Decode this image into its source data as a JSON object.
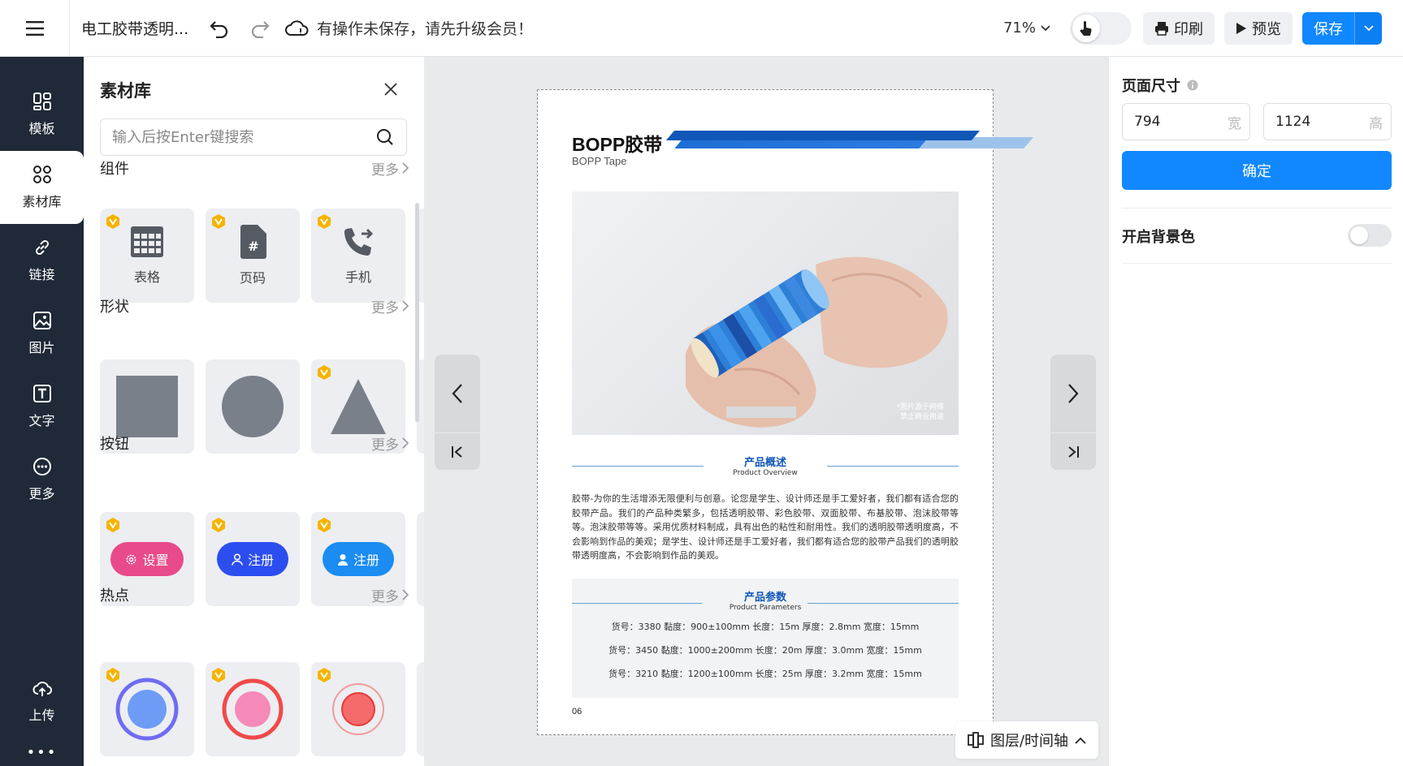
{
  "topbar": {
    "doc_title": "电工胶带透明...",
    "save_status": "有操作未保存，请先升级会员！",
    "zoom": "71%",
    "print_label": "印刷",
    "preview_label": "预览",
    "save_label": "保存"
  },
  "leftnav": {
    "items": [
      {
        "label": "模板"
      },
      {
        "label": "素材库"
      },
      {
        "label": "链接"
      },
      {
        "label": "图片"
      },
      {
        "label": "文字"
      },
      {
        "label": "更多"
      },
      {
        "label": "上传"
      }
    ],
    "dots": "•••"
  },
  "panel": {
    "title": "素材库",
    "search_placeholder": "输入后按Enter键搜索",
    "more_label": "更多",
    "sections": [
      {
        "name": "组件",
        "cards": [
          {
            "label": "表格"
          },
          {
            "label": "页码"
          },
          {
            "label": "手机"
          }
        ]
      },
      {
        "name": "形状"
      },
      {
        "name": "按钮",
        "buttons": [
          {
            "label": "设置",
            "color": "#e84a8a"
          },
          {
            "label": "注册",
            "color": "#2c4ef0"
          },
          {
            "label": "注册",
            "color": "#1b8cf2"
          }
        ]
      },
      {
        "name": "热点"
      }
    ]
  },
  "page": {
    "title": "BOPP胶带",
    "subtitle": "BOPP Tape",
    "photo_note_line1": "*图片源于网络",
    "photo_note_line2": "禁止商业用途",
    "overview_cn": "产品概述",
    "overview_en": "Product Overview",
    "overview_text": "胶带-为你的生活增添无限便利与创意。论您是学生、设计师还是手工爱好者，我们都有适合您的胶带产品。我们的产品种类繁多，包括透明胶带、彩色胶带、双面胶带、布基胶带、泡沫胶带等等。泡沫胶带等等。采用优质材料制成，具有出色的粘性和耐用性。我们的透明胶带透明度高，不会影响到作品的美观；是学生、设计师还是手工爱好者，我们都有适合您的胶带产品我们的透明胶带透明度高，不会影响到作品的美观。",
    "params_cn": "产品参数",
    "params_en": "Product Parameters",
    "params": [
      "货号：3380 黏度：900±100mm 长度：15m 厚度：2.8mm 宽度：15mm",
      "货号：3450 黏度：1000±200mm 长度：20m 厚度：3.0mm 宽度：15mm",
      "货号：3210 黏度：1200±100mm 长度：25m 厚度：3.2mm 宽度：15mm"
    ],
    "page_number": "06"
  },
  "layers_label": "图层/时间轴",
  "rpanel": {
    "size_title": "页面尺寸",
    "width_value": "794",
    "width_unit": "宽",
    "height_value": "1124",
    "height_unit": "高",
    "confirm_label": "确定",
    "bg_label": "开启背景色"
  },
  "colors": {
    "accent": "#1188ff",
    "nav_bg": "#1f2937",
    "brand_blue": "#1057b8",
    "vip": "#f5b400"
  }
}
